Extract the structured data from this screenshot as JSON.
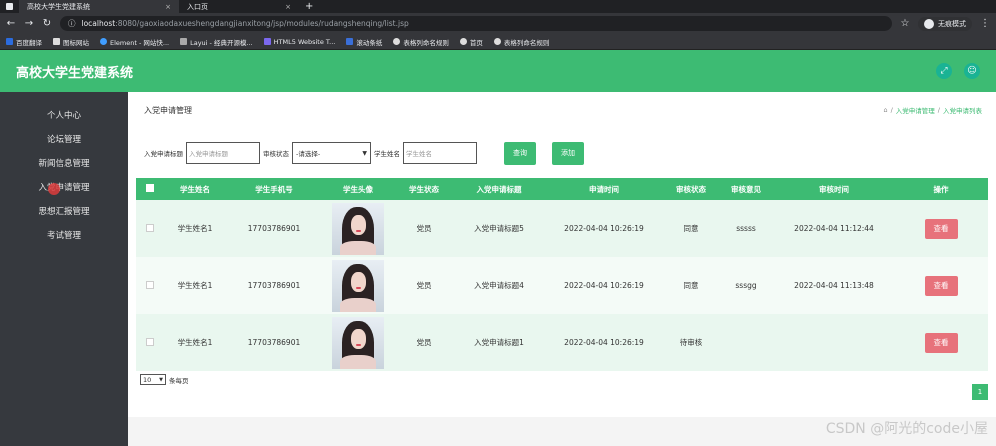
{
  "browser": {
    "tabs": [
      {
        "title": "高校大学生党建系统",
        "close": "×"
      },
      {
        "title": "入口页",
        "close": "×"
      }
    ],
    "new_tab": "+",
    "url_host": "localhost",
    "url_path": ":8080/gaoxiaodaxueshengdangjianxitong/jsp/modules/rudangshenqing/list.jsp",
    "profile_label": "无痕模式",
    "bookmarks": [
      "百度翻译",
      "图标网站",
      "Element - 网站快...",
      "Layui - 经典开源模...",
      "HTML5 Website T...",
      "滚动条纸",
      "表格列命名规则",
      "首页",
      "表格列命名规则"
    ]
  },
  "app": {
    "title": "高校大学生党建系统"
  },
  "sidebar": {
    "items": [
      "个人中心",
      "论坛管理",
      "新闻信息管理",
      "入党申请管理",
      "思想汇报管理",
      "考试管理"
    ]
  },
  "main": {
    "page_title": "入党申请管理",
    "breadcrumb": {
      "separator": "/",
      "parent": "入党申请管理",
      "current": "入党申请列表"
    },
    "filters": {
      "title_label": "入党申请标题",
      "title_placeholder": "入党申请标题",
      "status_label": "审核状态",
      "status_value": "-请选择-",
      "name_label": "学生姓名",
      "name_placeholder": "学生姓名",
      "search_button": "查询",
      "add_button": "添加"
    },
    "table": {
      "columns": [
        "学生姓名",
        "学生手机号",
        "学生头像",
        "学生状态",
        "入党申请标题",
        "申请时间",
        "审核状态",
        "审核意见",
        "审核时间",
        "操作"
      ],
      "rows": [
        {
          "name": "学生姓名1",
          "phone": "17703786901",
          "status": "党员",
          "title": "入党申请标题5",
          "apply_time": "2022-04-04 10:26:19",
          "review_status": "同意",
          "review_opinion": "sssss",
          "review_time": "2022-04-04 11:12:44",
          "action": "查看"
        },
        {
          "name": "学生姓名1",
          "phone": "17703786901",
          "status": "党员",
          "title": "入党申请标题4",
          "apply_time": "2022-04-04 10:26:19",
          "review_status": "同意",
          "review_opinion": "sssgg",
          "review_time": "2022-04-04 11:13:48",
          "action": "查看"
        },
        {
          "name": "学生姓名1",
          "phone": "17703786901",
          "status": "党员",
          "title": "入党申请标题1",
          "apply_time": "2022-04-04 10:26:19",
          "review_status": "待审核",
          "review_opinion": "",
          "review_time": "",
          "action": "查看"
        }
      ]
    },
    "pager": {
      "size_value": "10",
      "size_suffix": "条每页",
      "current_page": "1"
    }
  },
  "watermark": "CSDN @阿光的code小屋",
  "colors": {
    "primary": "#3dbb73",
    "sidebar": "#36393e",
    "danger": "#e7727b"
  }
}
